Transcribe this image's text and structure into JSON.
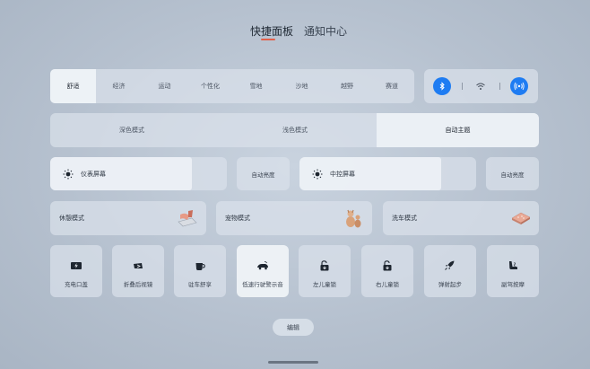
{
  "tabs": [
    {
      "label": "快捷面板",
      "active": true
    },
    {
      "label": "通知中心",
      "active": false
    }
  ],
  "drive_modes": {
    "selected": "舒适",
    "items": [
      "舒适",
      "经济",
      "运动",
      "个性化",
      "雪地",
      "沙地",
      "越野",
      "赛道"
    ]
  },
  "connectivity": {
    "bluetooth": {
      "icon": "bluetooth-icon",
      "on": true
    },
    "wifi": {
      "icon": "wifi-icon",
      "on": false
    },
    "hotspot": {
      "icon": "hotspot-icon",
      "on": true
    }
  },
  "themes": {
    "selected": "自动主题",
    "items": [
      "深色模式",
      "浅色模式",
      "自动主题"
    ]
  },
  "brightness": {
    "instrument": {
      "label": "仪表屏幕",
      "auto_label": "自动亮度",
      "level": 0.8
    },
    "center": {
      "label": "中控屏幕",
      "auto_label": "自动亮度",
      "level": 0.8
    }
  },
  "scenes": [
    {
      "label": "休憩模式",
      "icon": "rest-mode-icon"
    },
    {
      "label": "宠物模式",
      "icon": "pet-mode-icon"
    },
    {
      "label": "洗车模式",
      "icon": "car-wash-icon"
    }
  ],
  "toggles": [
    {
      "label": "充电口盖",
      "icon": "charge-port-icon",
      "on": false
    },
    {
      "label": "折叠后视镜",
      "icon": "fold-mirror-icon",
      "on": false
    },
    {
      "label": "驻车舒享",
      "icon": "cup-icon",
      "on": false
    },
    {
      "label": "低速行驶警示音",
      "icon": "pedestrian-warning-icon",
      "on": true
    },
    {
      "label": "左儿童锁",
      "icon": "left-child-lock-icon",
      "on": false
    },
    {
      "label": "右儿童锁",
      "icon": "right-child-lock-icon",
      "on": false
    },
    {
      "label": "弹射起步",
      "icon": "rocket-icon",
      "on": false
    },
    {
      "label": "副驾按摩",
      "icon": "seat-massage-icon",
      "on": false
    }
  ],
  "edit_label": "编辑",
  "colors": {
    "accent": "#1e7cf2",
    "tab_underline": "#e2604a"
  }
}
